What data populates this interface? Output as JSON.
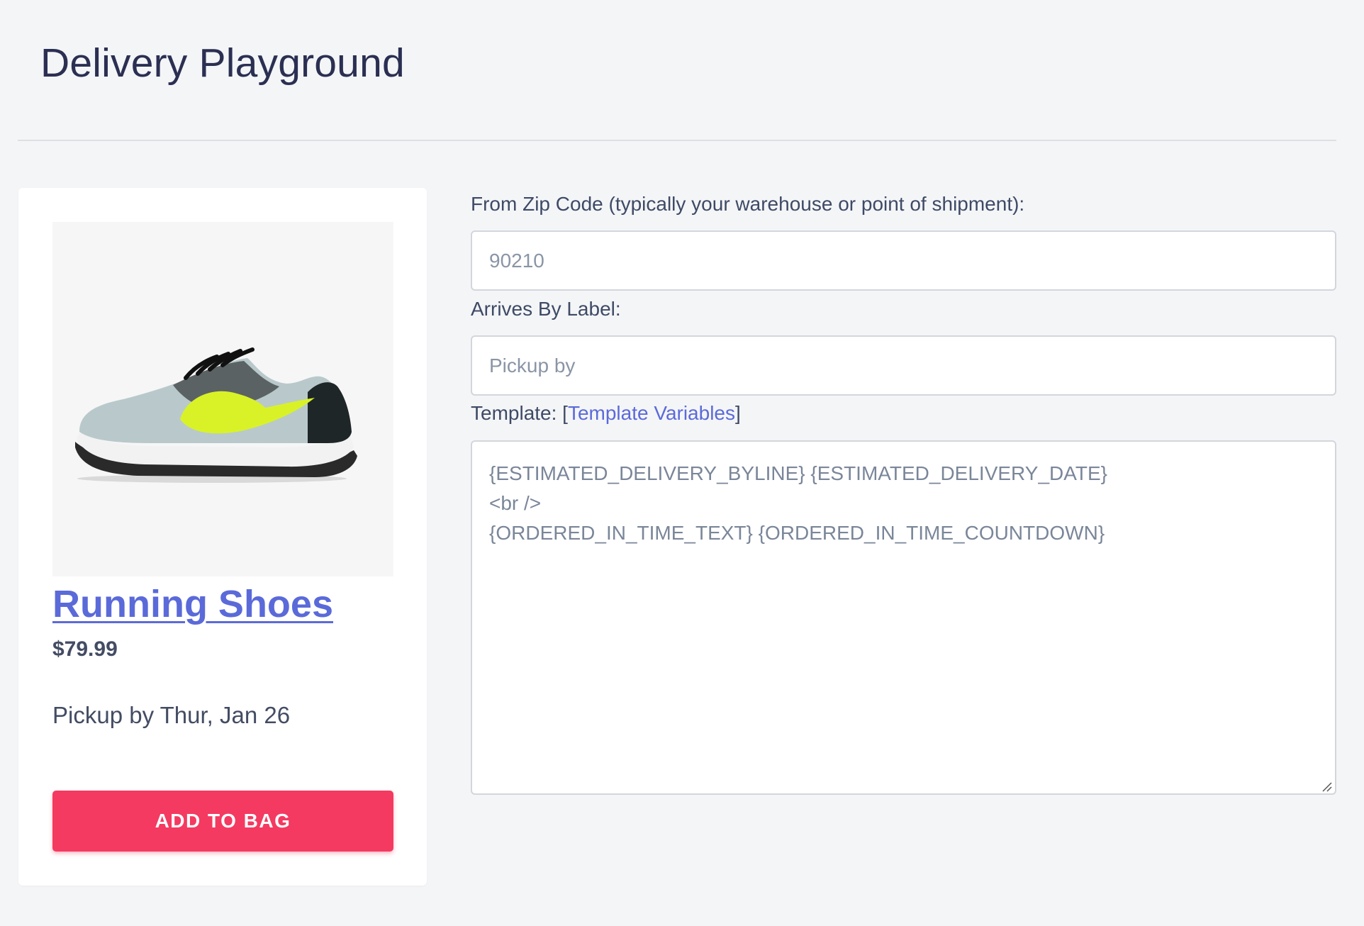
{
  "page": {
    "title": "Delivery Playground"
  },
  "product": {
    "name": "Running Shoes",
    "price": "$79.99",
    "delivery_text": "Pickup by Thur, Jan 26",
    "add_button_label": "ADD TO BAG",
    "image_icon": "shoe-image"
  },
  "form": {
    "zip_label": "From Zip Code (typically your warehouse or point of shipment):",
    "zip_value": "90210",
    "arrives_label": "Arrives By Label:",
    "arrives_value": "Pickup by",
    "template_label_prefix": "Template: [",
    "template_link": "Template Variables",
    "template_label_suffix": "]",
    "template_value": "{ESTIMATED_DELIVERY_BYLINE} {ESTIMATED_DELIVERY_DATE}\n<br />\n{ORDERED_IN_TIME_TEXT} {ORDERED_IN_TIME_COUNTDOWN}"
  },
  "colors": {
    "accent": "#5b6ad9",
    "button": "#f43a60",
    "background": "#f4f5f7"
  }
}
